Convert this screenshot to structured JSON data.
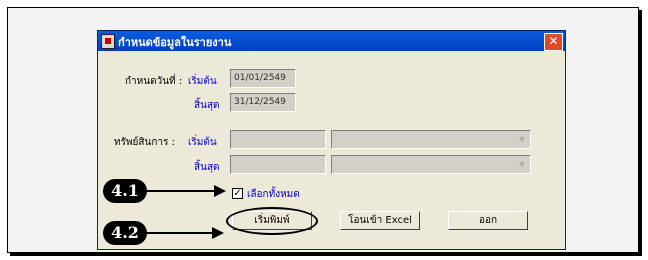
{
  "window": {
    "title": "กำหนดข้อมูลในรายงาน"
  },
  "date_range": {
    "label": "กำหนดวันที่ :",
    "start_label": "เริ่มต้น",
    "start_value": "01/01/2549",
    "end_label": "สิ้นสุด",
    "end_value": "31/12/2549"
  },
  "asset_range": {
    "label": "ทรัพย์สินการ :",
    "start_label": "เริ่มต้น",
    "end_label": "สิ้นสุด"
  },
  "select_all": {
    "label": "เลือกทั้งหมด",
    "checked": true
  },
  "buttons": {
    "print": "เริ่มพิมพ์",
    "export": "โอนเข้า Excel",
    "exit": "ออก"
  },
  "callouts": [
    "4.1",
    "4.2"
  ]
}
